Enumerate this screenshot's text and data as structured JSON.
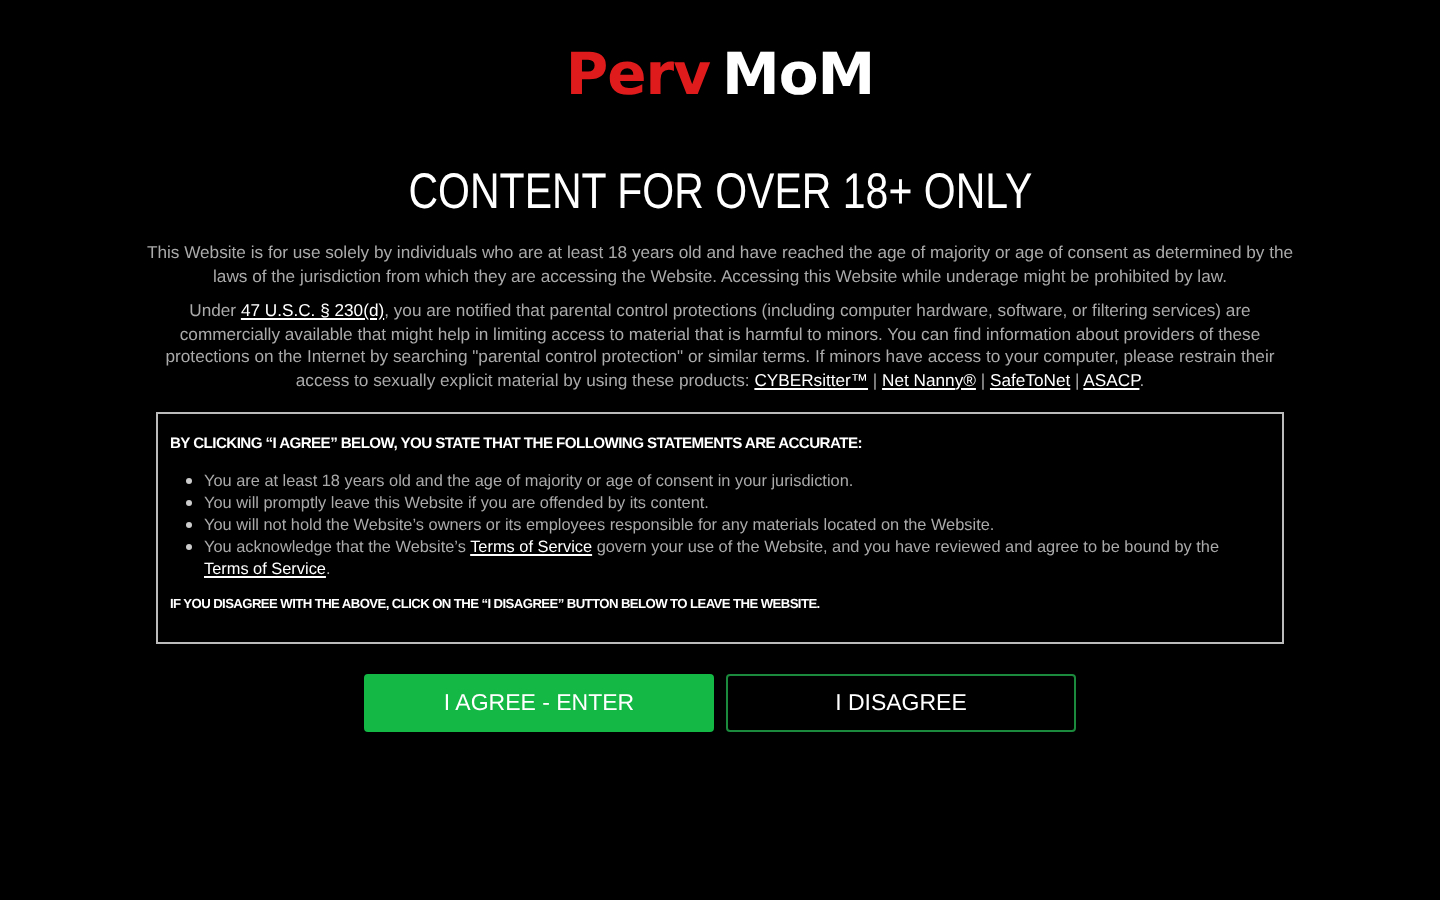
{
  "logo": {
    "parts": [
      {
        "text": "Perv",
        "color": "#e01b1b"
      },
      {
        "text": "MoM",
        "color": "#ffffff"
      }
    ]
  },
  "heading": "CONTENT FOR OVER 18+ ONLY",
  "paragraphs": [
    [
      {
        "kind": "text",
        "text": "This Website is for use solely by individuals who are at least 18 years old and have reached the age of majority or age of consent as determined by the laws of the jurisdiction from which they are accessing the Website. Accessing this Website while underage might be prohibited by law."
      }
    ],
    [
      {
        "kind": "text",
        "text": "Under "
      },
      {
        "kind": "link",
        "text": "47 U.S.C. § 230(d)"
      },
      {
        "kind": "text",
        "text": ", you are notified that parental control protections (including computer hardware, software, or filtering services) are commercially available that might help in limiting access to material that is harmful to minors. You can find information about providers of these protections on the Internet by searching \"parental control protection\" or similar terms. If minors have access to your computer, please restrain their access to sexually explicit material by using these products: "
      },
      {
        "kind": "link",
        "text": "CYBERsitter™"
      },
      {
        "kind": "text",
        "text": " | "
      },
      {
        "kind": "link",
        "text": "Net Nanny®"
      },
      {
        "kind": "text",
        "text": " | "
      },
      {
        "kind": "link",
        "text": "SafeToNet"
      },
      {
        "kind": "text",
        "text": " | "
      },
      {
        "kind": "link",
        "text": "ASACP"
      },
      {
        "kind": "text",
        "text": "."
      }
    ]
  ],
  "notice": {
    "title": "BY CLICKING “I AGREE” BELOW, YOU STATE THAT THE FOLLOWING STATEMENTS ARE ACCURATE:",
    "items": [
      [
        {
          "kind": "text",
          "text": "You are at least 18 years old and the age of majority or age of consent in your jurisdiction."
        }
      ],
      [
        {
          "kind": "text",
          "text": "You will promptly leave this Website if you are offended by its content."
        }
      ],
      [
        {
          "kind": "text",
          "text": "You will not hold the Website’s owners or its employees responsible for any materials located on the Website."
        }
      ],
      [
        {
          "kind": "text",
          "text": "You acknowledge that the Website’s "
        },
        {
          "kind": "link",
          "text": "Terms of Service"
        },
        {
          "kind": "text",
          "text": " govern your use of the Website, and you have reviewed and agree to be bound by the "
        },
        {
          "kind": "link",
          "text": "Terms of Service"
        },
        {
          "kind": "text",
          "text": "."
        }
      ]
    ],
    "footer": "IF YOU DISAGREE WITH THE ABOVE, CLICK ON THE “I DISAGREE” BUTTON BELOW TO LEAVE THE WEBSITE."
  },
  "buttons": [
    {
      "label": "I AGREE - ENTER",
      "kind": "primary"
    },
    {
      "label": "I DISAGREE",
      "kind": "outline"
    }
  ]
}
